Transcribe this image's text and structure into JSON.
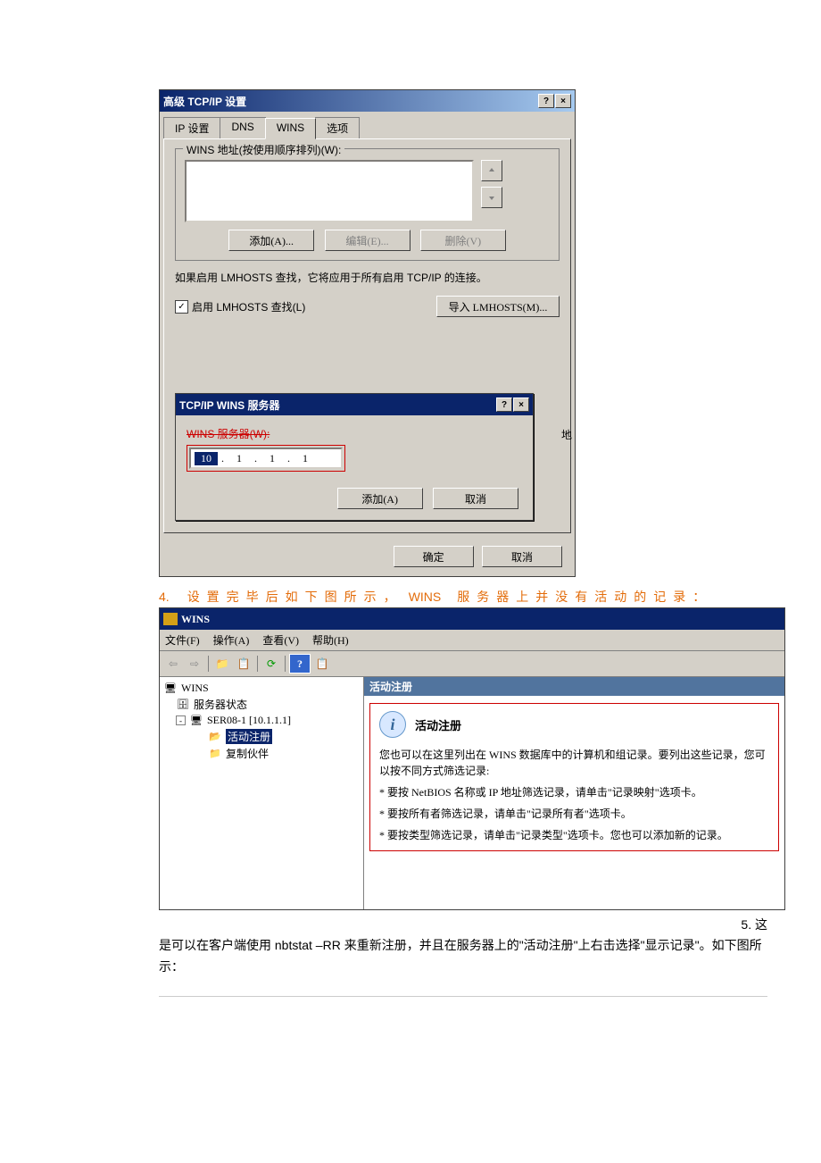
{
  "dialog1": {
    "title": "高级 TCP/IP 设置",
    "tabs": {
      "ip": "IP 设置",
      "dns": "DNS",
      "wins": "WINS",
      "options": "选项"
    },
    "group_wins_addr": "WINS 地址(按使用顺序排列)(W):",
    "btn_add": "添加(A)...",
    "btn_edit": "编辑(E)...",
    "btn_delete": "删除(V)",
    "note": "如果启用 LMHOSTS 查找，它将应用于所有启用 TCP/IP 的连接。",
    "chk_lmhosts": "启用 LMHOSTS 查找(L)",
    "btn_import": "导入 LMHOSTS(M)...",
    "peek_char": "地",
    "ok": "确定",
    "cancel": "取消"
  },
  "innerdlg": {
    "title": "TCP/IP WINS 服务器",
    "label_strike": "WINS 服务器(W):",
    "ip": {
      "o1": "10",
      "o2": "1",
      "o3": "1",
      "o4": "1"
    },
    "btn_add": "添加(A)",
    "btn_cancel": "取消"
  },
  "step4": {
    "num": "4.",
    "text_a": "设置完毕后如下图所示，",
    "wins": "WINS",
    "text_b": "服务器上并没有活动的记录："
  },
  "mmc": {
    "title": "WINS",
    "menu": {
      "file": "文件(F)",
      "action": "操作(A)",
      "view": "查看(V)",
      "help": "帮助(H)"
    },
    "tree": {
      "root": "WINS",
      "status": "服务器状态",
      "server": "SER08-1 [10.1.1.1]",
      "active": "活动注册",
      "partner": "复制伙伴"
    },
    "right": {
      "header": "活动注册",
      "title": "活动注册",
      "p1": "您也可以在这里列出在 WINS 数据库中的计算机和组记录。要列出这些记录，您可以按不同方式筛选记录:",
      "b1": "* 要按 NetBIOS 名称或 IP 地址筛选记录，请单击\"记录映射\"选项卡。",
      "b2": "* 要按所有者筛选记录，请单击\"记录所有者\"选项卡。",
      "b3": "* 要按类型筛选记录，请单击\"记录类型\"选项卡。您也可以添加新的记录。"
    }
  },
  "step5": {
    "num": "5. 这",
    "line": "是可以在客户端使用 nbtstat –RR 来重新注册，并且在服务器上的\"活动注册\"上右击选择\"显示记录\"。如下图所示："
  }
}
